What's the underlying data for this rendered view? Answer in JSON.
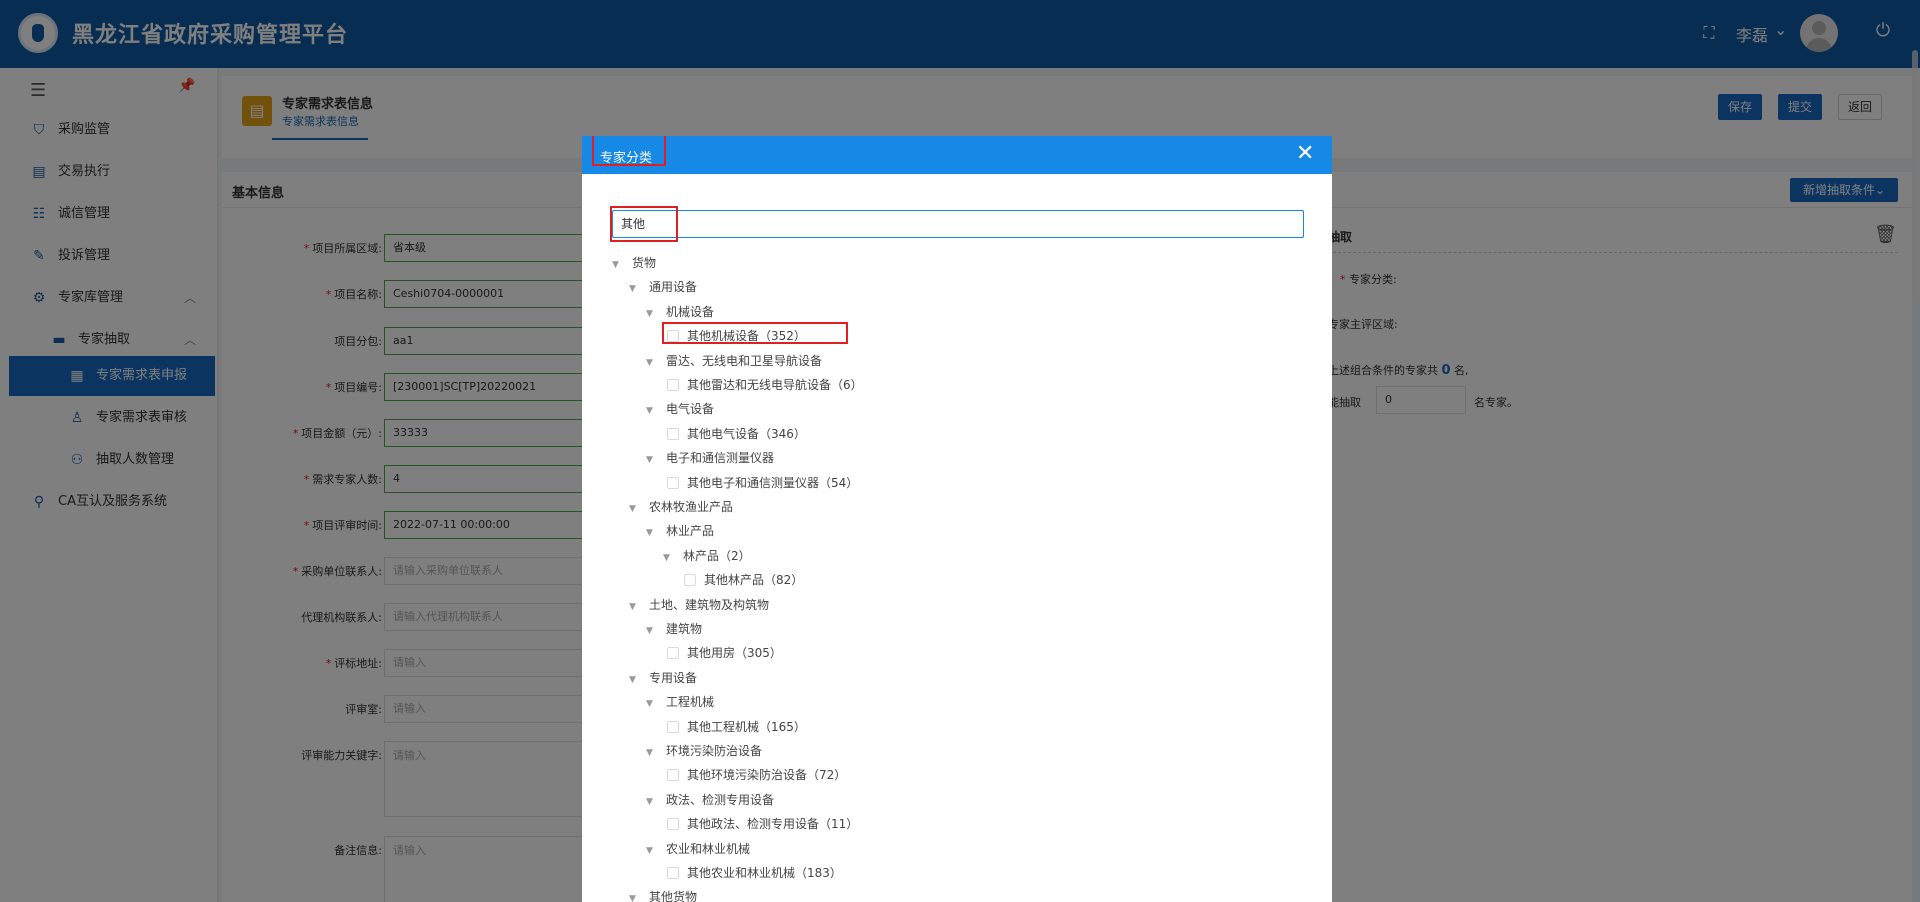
{
  "header": {
    "title": "黑龙江省政府采购管理平台",
    "user": "李磊"
  },
  "sidebar": {
    "items": [
      {
        "label": "采购监管",
        "icon": "shield-icon"
      },
      {
        "label": "交易执行",
        "icon": "document-icon"
      },
      {
        "label": "诚信管理",
        "icon": "list-icon"
      },
      {
        "label": "投诉管理",
        "icon": "edit-icon"
      },
      {
        "label": "专家库管理",
        "icon": "gear-icon"
      },
      {
        "label": "专家抽取",
        "icon": "monitor-icon"
      },
      {
        "label": "专家需求表申报",
        "icon": "form-icon"
      },
      {
        "label": "专家需求表审核",
        "icon": "user-icon"
      },
      {
        "label": "抽取人数管理",
        "icon": "users-icon"
      },
      {
        "label": "CA互认及服务系统",
        "icon": "certificate-icon"
      }
    ]
  },
  "page": {
    "title": "专家需求表信息",
    "tab": "专家需求表信息",
    "buttons": {
      "save": "保存",
      "submit": "提交",
      "back": "返回"
    }
  },
  "basic": {
    "title": "基本信息",
    "add_condition": "新增抽取条件",
    "fields": [
      {
        "label": "项目所属区域:",
        "required": true,
        "value": "省本级",
        "placeholder": ""
      },
      {
        "label": "项目名称:",
        "required": true,
        "value": "Ceshi0704-0000001",
        "placeholder": ""
      },
      {
        "label": "项目分包:",
        "required": false,
        "value": "aa1",
        "placeholder": ""
      },
      {
        "label": "项目编号:",
        "required": true,
        "value": "[230001]SC[TP]20220021",
        "placeholder": ""
      },
      {
        "label": "项目金额（元）:",
        "required": true,
        "value": "33333",
        "placeholder": ""
      },
      {
        "label": "需求专家人数:",
        "required": true,
        "value": "4",
        "placeholder": ""
      },
      {
        "label": "项目评审时间:",
        "required": true,
        "value": "2022-07-11 00:00:00",
        "placeholder": ""
      },
      {
        "label": "采购单位联系人:",
        "required": true,
        "value": "",
        "placeholder": "请输入采购单位联系人"
      },
      {
        "label": "代理机构联系人:",
        "required": false,
        "value": "",
        "placeholder": "请输入代理机构联系人"
      },
      {
        "label": "评标地址:",
        "required": true,
        "value": "",
        "placeholder": "请输入"
      },
      {
        "label": "评审室:",
        "required": false,
        "value": "",
        "placeholder": "请输入"
      },
      {
        "label": "评审能力关键字:",
        "required": false,
        "value": "",
        "placeholder": "请输入"
      },
      {
        "label": "备注信息:",
        "required": false,
        "value": "",
        "placeholder": "请输入"
      }
    ],
    "draw": {
      "title": "抽取",
      "category_label": "专家分类:",
      "region_label": "专家主评区域:",
      "summary_prefix": "上述组合条件的专家共",
      "summary_count": "0",
      "summary_suffix": "名,",
      "can_draw_label": "能抽取",
      "can_draw_value": "0",
      "can_draw_suffix": "名专家。"
    }
  },
  "modal": {
    "title": "专家分类",
    "search_value": "其他",
    "tree": [
      {
        "label": "货物",
        "level": 0,
        "type": "toggle"
      },
      {
        "label": "通用设备",
        "level": 1,
        "type": "toggle"
      },
      {
        "label": "机械设备",
        "level": 2,
        "type": "toggle"
      },
      {
        "label": "其他机械设备（352）",
        "level": 3,
        "type": "check"
      },
      {
        "label": "雷达、无线电和卫星导航设备",
        "level": 2,
        "type": "toggle"
      },
      {
        "label": "其他雷达和无线电导航设备（6）",
        "level": 3,
        "type": "check"
      },
      {
        "label": "电气设备",
        "level": 2,
        "type": "toggle"
      },
      {
        "label": "其他电气设备（346）",
        "level": 3,
        "type": "check"
      },
      {
        "label": "电子和通信测量仪器",
        "level": 2,
        "type": "toggle"
      },
      {
        "label": "其他电子和通信测量仪器（54）",
        "level": 3,
        "type": "check"
      },
      {
        "label": "农林牧渔业产品",
        "level": 1,
        "type": "toggle"
      },
      {
        "label": "林业产品",
        "level": 2,
        "type": "toggle"
      },
      {
        "label": "林产品（2）",
        "level": 3,
        "type": "toggle"
      },
      {
        "label": "其他林产品（82）",
        "level": 4,
        "type": "check"
      },
      {
        "label": "土地、建筑物及构筑物",
        "level": 1,
        "type": "toggle"
      },
      {
        "label": "建筑物",
        "level": 2,
        "type": "toggle"
      },
      {
        "label": "其他用房（305）",
        "level": 3,
        "type": "check"
      },
      {
        "label": "专用设备",
        "level": 1,
        "type": "toggle"
      },
      {
        "label": "工程机械",
        "level": 2,
        "type": "toggle"
      },
      {
        "label": "其他工程机械（165）",
        "level": 3,
        "type": "check"
      },
      {
        "label": "环境污染防治设备",
        "level": 2,
        "type": "toggle"
      },
      {
        "label": "其他环境污染防治设备（72）",
        "level": 3,
        "type": "check"
      },
      {
        "label": "政法、检测专用设备",
        "level": 2,
        "type": "toggle"
      },
      {
        "label": "其他政法、检测专用设备（11）",
        "level": 3,
        "type": "check"
      },
      {
        "label": "农业和林业机械",
        "level": 2,
        "type": "toggle"
      },
      {
        "label": "其他农业和林业机械（183）",
        "level": 3,
        "type": "check"
      },
      {
        "label": "其他货物",
        "level": 1,
        "type": "toggle"
      }
    ]
  },
  "colors": {
    "header": "#0f5aa6",
    "accent": "#1668c0",
    "modal_header": "#1688e6",
    "highlight": "#e02020"
  }
}
